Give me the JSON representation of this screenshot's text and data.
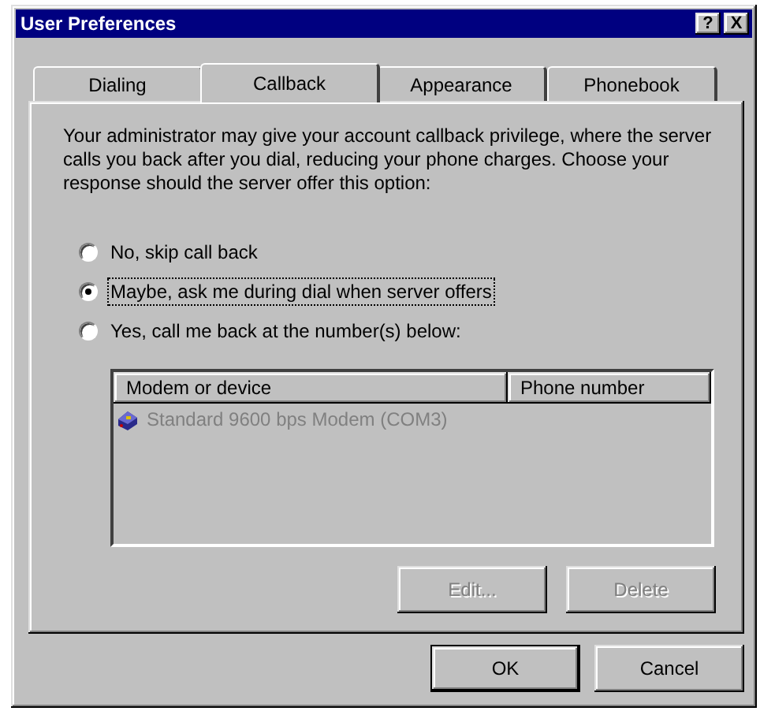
{
  "window": {
    "title": "User Preferences",
    "help_button": "?",
    "close_button": "X"
  },
  "tabs": [
    {
      "label": "Dialing",
      "selected": false
    },
    {
      "label": "Callback",
      "selected": true
    },
    {
      "label": "Appearance",
      "selected": false
    },
    {
      "label": "Phonebook",
      "selected": false
    }
  ],
  "description": "Your administrator may give your account callback privilege, where the server calls you back after you dial, reducing your phone charges.  Choose your response should the server offer this option:",
  "options": [
    {
      "label": "No, skip call back",
      "selected": false,
      "focused": false
    },
    {
      "label": "Maybe, ask me during dial when server offers",
      "selected": true,
      "focused": true
    },
    {
      "label": "Yes, call me back at the number(s) below:",
      "selected": false,
      "focused": false
    }
  ],
  "device_list": {
    "disabled": true,
    "columns": [
      "Modem or device",
      "Phone number"
    ],
    "rows": [
      {
        "device": "Standard  9600 bps Modem (COM3)"
      }
    ]
  },
  "list_buttons": [
    {
      "label": "Edit...",
      "disabled": true
    },
    {
      "label": "Delete",
      "disabled": true
    }
  ],
  "dialog_buttons": [
    {
      "label": "OK",
      "default": true
    },
    {
      "label": "Cancel",
      "default": false
    }
  ]
}
